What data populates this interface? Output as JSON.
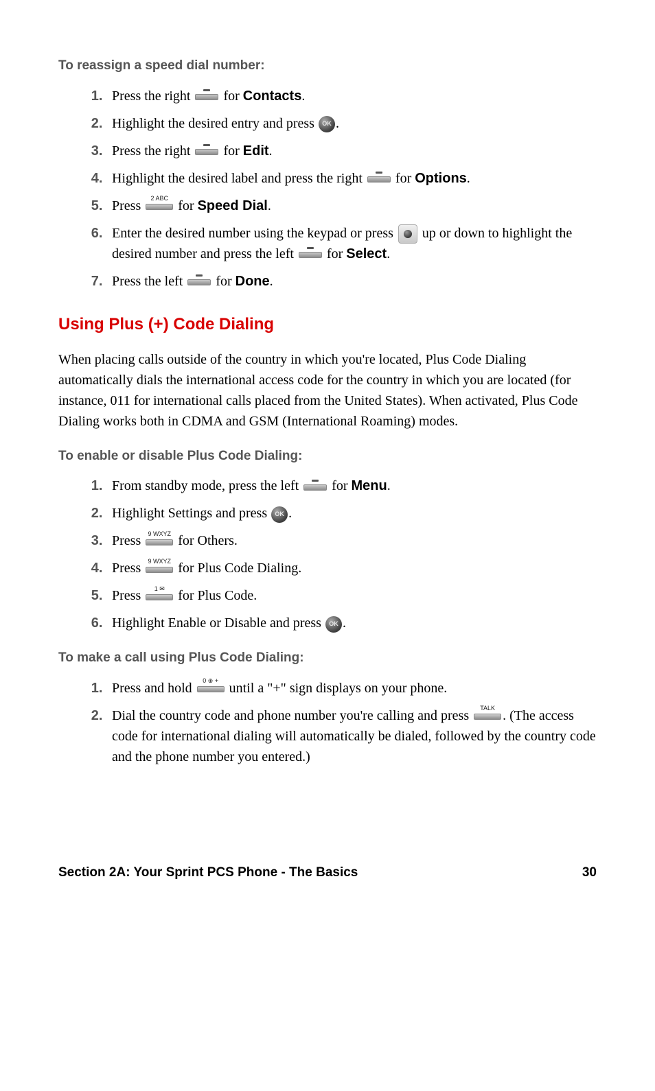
{
  "section1": {
    "heading": "To reassign a speed dial number:",
    "steps": [
      {
        "pre": "Press the right ",
        "icon": "softkey",
        "mid": " for ",
        "bold": "Contacts",
        "post": "."
      },
      {
        "pre": "Highlight the desired entry and press ",
        "icon": "ok",
        "post": "."
      },
      {
        "pre": " Press the right ",
        "icon": "softkey",
        "mid": " for ",
        "bold": "Edit",
        "post": "."
      },
      {
        "pre": "Highlight the desired label and press the right ",
        "icon": "softkey",
        "mid": " for ",
        "bold": "Options",
        "post": "."
      },
      {
        "pre": "Press ",
        "icon": "key",
        "key_label": "2 ABC",
        "mid": " for ",
        "bold": "Speed Dial",
        "post": "."
      },
      {
        "pre": "Enter the desired number using the keypad or press ",
        "icon": "nav",
        "mid": " up or down to highlight the desired number and press the left ",
        "icon2": "softkey",
        "mid2": " for ",
        "bold": "Select",
        "post": "."
      },
      {
        "pre": "Press the left ",
        "icon": "softkey",
        "mid": " for ",
        "bold": "Done",
        "post": "."
      }
    ]
  },
  "section_title": "Using Plus (+) Code Dialing",
  "intro_para": "When placing calls outside of the country in which you're located, Plus Code Dialing automatically dials the international access code for the country in which you are located (for instance, 011 for international calls placed from the United States). When activated, Plus Code Dialing works both in CDMA and GSM (International Roaming) modes.",
  "section2": {
    "heading": "To enable or disable Plus Code Dialing:",
    "steps": [
      {
        "pre": "From standby mode, press the left ",
        "icon": "softkey",
        "mid": " for ",
        "bold": "Menu",
        "post": "."
      },
      {
        "pre": "Highlight Settings and press ",
        "icon": "ok",
        "post": "."
      },
      {
        "pre": "Press ",
        "icon": "key",
        "key_label": "9 WXYZ",
        "post": " for Others."
      },
      {
        "pre": "Press ",
        "icon": "key",
        "key_label": "9 WXYZ",
        "post": " for Plus Code Dialing."
      },
      {
        "pre": "Press ",
        "icon": "key",
        "key_label": "1 ✉",
        "post": " for Plus Code."
      },
      {
        "pre": "Highlight Enable or Disable and press ",
        "icon": "ok",
        "post": "."
      }
    ]
  },
  "section3": {
    "heading": "To make a call using Plus Code Dialing:",
    "steps": [
      {
        "pre": "Press and hold ",
        "icon": "key",
        "key_label": "0 ⊕ +",
        "post": " until a \"+\" sign displays on your phone."
      },
      {
        "pre": "Dial the country code and phone number you're calling and press ",
        "icon": "key",
        "key_label": "TALK",
        "post": ". (The access code for international dialing will automatically be dialed, followed by the country code and the phone number you entered.)"
      }
    ]
  },
  "footer": {
    "left": "Section 2A: Your Sprint PCS Phone - The Basics",
    "right": "30"
  }
}
